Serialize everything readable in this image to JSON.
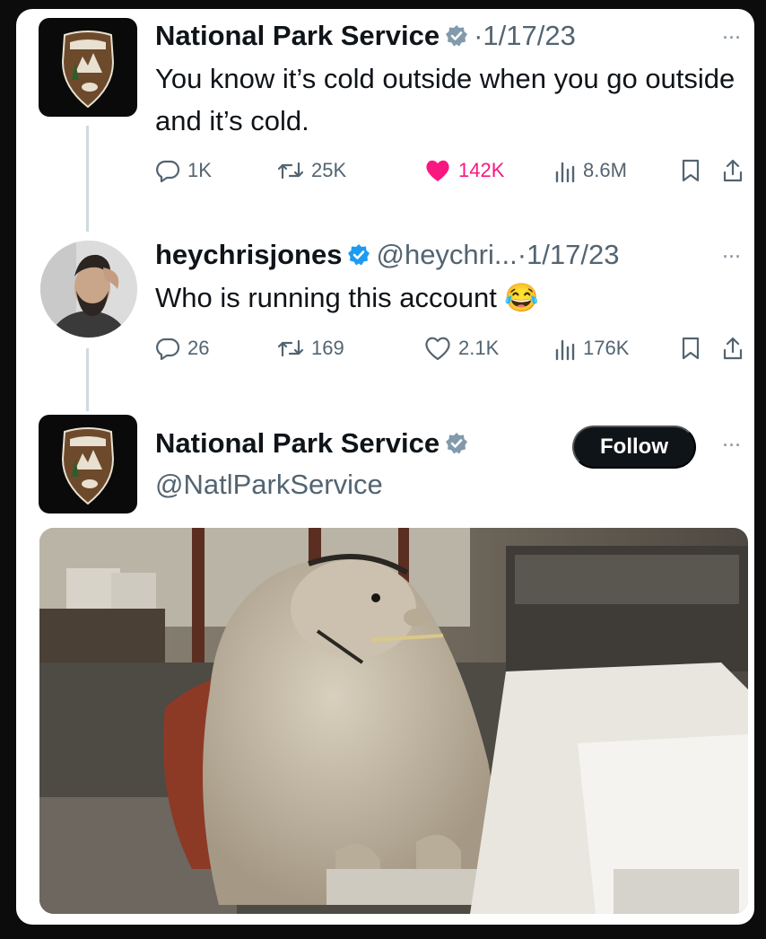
{
  "tweet1": {
    "author": "National Park Service",
    "date": "1/17/23",
    "text": "You know it’s cold outside when you go outside and it’s cold.",
    "replies": "1K",
    "retweets": "25K",
    "likes": "142K",
    "views": "8.6M"
  },
  "tweet2": {
    "author": "heychrisjones",
    "handle": "@heychri...",
    "date": "1/17/23",
    "text": "Who is running this account 😂",
    "replies": "26",
    "retweets": "169",
    "likes": "2.1K",
    "views": "176K"
  },
  "tweet3": {
    "author": "National Park Service",
    "handle": "@NatlParkService",
    "follow_label": "Follow"
  },
  "ui": {
    "separator": "·",
    "more": "···"
  },
  "colors": {
    "verified_badge": "#829aab",
    "like_pink": "#f91880",
    "muted": "#536471"
  },
  "icons": [
    "reply-icon",
    "retweet-icon",
    "heart-icon",
    "views-icon",
    "bookmark-icon",
    "share-icon",
    "verified-badge-icon",
    "nps-arrowhead-logo"
  ]
}
